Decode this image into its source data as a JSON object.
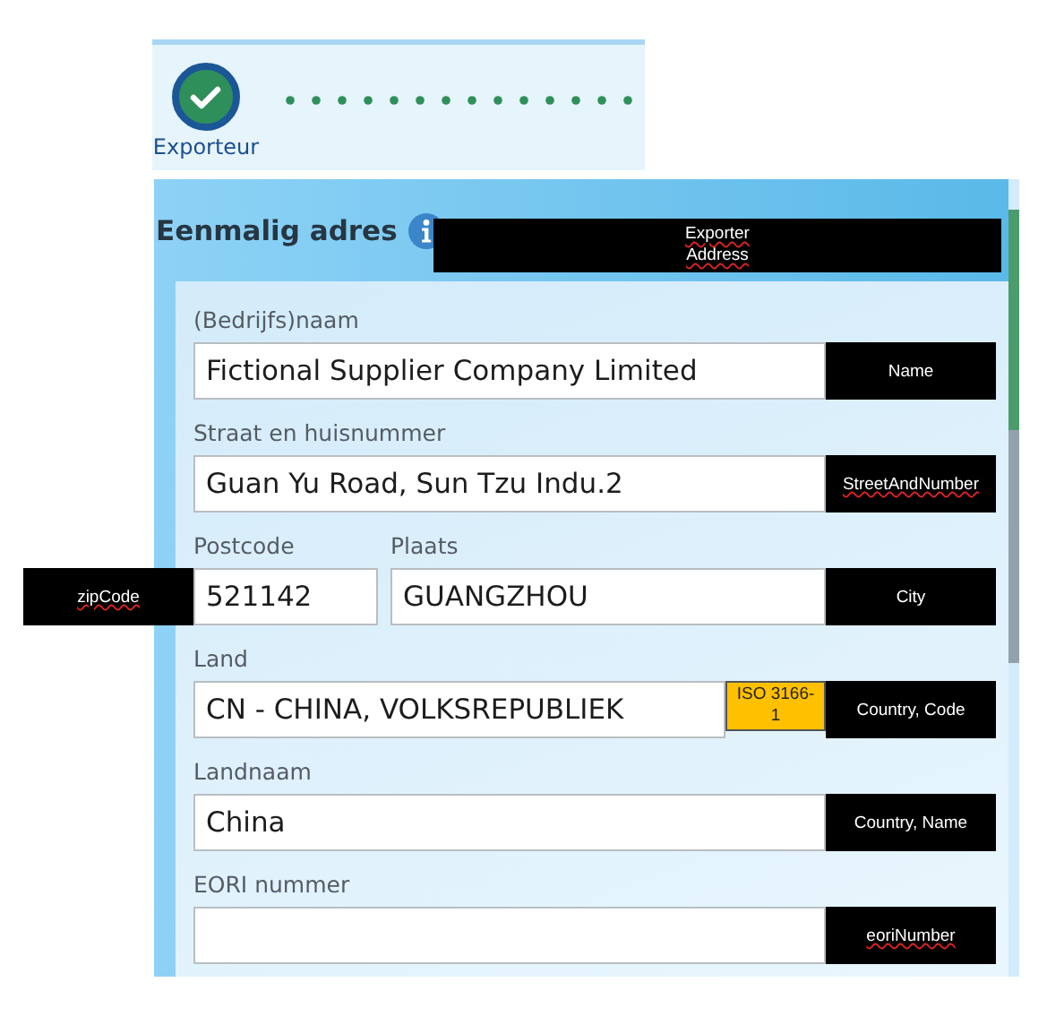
{
  "steps": [
    {
      "label": "Exporteur",
      "done": true
    }
  ],
  "panel": {
    "title": "Eenmalig adres",
    "annotations": [
      {
        "text": "Exporter Address",
        "kind": "header_tag",
        "spell_underline": true
      }
    ]
  },
  "rows": [
    {
      "fields": [
        {
          "label": "(Bedrijfs)naam",
          "value": "Fictional Supplier Company Limited",
          "kind": "text",
          "annotations": [
            {
              "text": "Name",
              "kind": "tag",
              "spell_underline": false
            }
          ]
        }
      ]
    },
    {
      "fields": [
        {
          "label": "Straat en huisnummer",
          "value": "Guan Yu Road, Sun Tzu Indu.2",
          "kind": "text",
          "annotations": [
            {
              "text": "StreetAndNumber",
              "kind": "tag",
              "spell_underline": true
            }
          ]
        }
      ]
    },
    {
      "fields": [
        {
          "label": "Postcode",
          "value": "521142",
          "kind": "short",
          "annotations": [
            {
              "text": "zipCode",
              "kind": "tag_left",
              "spell_underline": true
            }
          ]
        },
        {
          "label": "Plaats",
          "value": "GUANGZHOU",
          "kind": "text",
          "annotations": [
            {
              "text": "City",
              "kind": "tag",
              "spell_underline": false
            }
          ]
        }
      ]
    },
    {
      "fields": [
        {
          "label": "Land",
          "value": "CN - CHINA, VOLKSREPUBLIEK",
          "kind": "select",
          "annotations": [
            {
              "text": "ISO 3166-1",
              "kind": "note",
              "spell_underline": false
            },
            {
              "text": "Country, Code",
              "kind": "tag",
              "spell_underline": false
            }
          ]
        }
      ]
    },
    {
      "fields": [
        {
          "label": "Landnaam",
          "value": "China",
          "kind": "text",
          "annotations": [
            {
              "text": "Country, Name",
              "kind": "tag",
              "spell_underline": false
            }
          ]
        }
      ]
    },
    {
      "fields": [
        {
          "label": "EORI nummer",
          "kind": "text",
          "annotations": [
            {
              "text": "eoriNumber",
              "kind": "tag",
              "spell_underline": true
            }
          ]
        }
      ]
    }
  ]
}
